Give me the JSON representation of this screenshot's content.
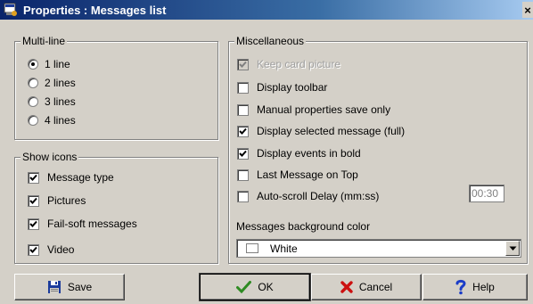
{
  "window": {
    "title": "Properties : Messages list",
    "close_label": "×"
  },
  "multiline": {
    "label": "Multi-line",
    "options": [
      "1 line",
      "2 lines",
      "3 lines",
      "4 lines"
    ],
    "selected": "1 line"
  },
  "show_icons": {
    "label": "Show icons",
    "items": [
      {
        "label": "Message type",
        "checked": true
      },
      {
        "label": "Pictures",
        "checked": true
      },
      {
        "label": "Fail-soft messages",
        "checked": true
      },
      {
        "label": "Video",
        "checked": true
      }
    ]
  },
  "misc": {
    "label": "Miscellaneous",
    "items": [
      {
        "label": "Keep card picture",
        "checked": true,
        "disabled": true
      },
      {
        "label": "Display toolbar",
        "checked": false
      },
      {
        "label": "Manual properties save only",
        "checked": false
      },
      {
        "label": "Display selected message (full)",
        "checked": true
      },
      {
        "label": "Display events in bold",
        "checked": true
      },
      {
        "label": "Last Message on Top",
        "checked": false
      },
      {
        "label": "Auto-scroll Delay (mm:ss)",
        "checked": false
      }
    ],
    "auto_scroll_value": "00:30",
    "bg_color_label": "Messages background color",
    "bg_color_value": "White"
  },
  "buttons": {
    "save": "Save",
    "ok": "OK",
    "cancel": "Cancel",
    "help": "Help"
  },
  "colors": {
    "title_start": "#0a246a",
    "title_end": "#a6caf0",
    "face": "#d4d0c8",
    "ok_check": "#2e8b22",
    "cancel_x": "#cc1010",
    "help_q": "#1a3cc8",
    "save_disk": "#1c3c9c"
  },
  "icons": {
    "app": "app-window-icon",
    "save": "floppy-disk-icon",
    "ok": "check-mark-icon",
    "cancel": "red-x-icon",
    "help": "question-mark-icon",
    "dropdown": "chevron-down-icon"
  }
}
